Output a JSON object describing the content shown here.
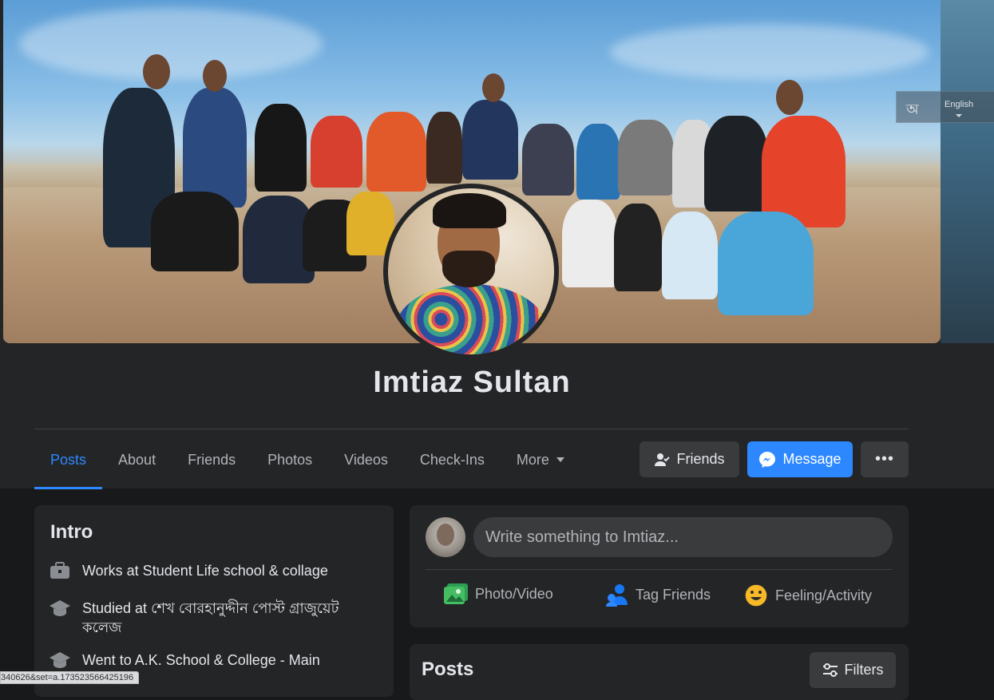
{
  "language_widget": {
    "bangla": "অ",
    "english": "English"
  },
  "profile": {
    "name": "Imtiaz Sultan"
  },
  "tabs": [
    {
      "label": "Posts"
    },
    {
      "label": "About"
    },
    {
      "label": "Friends"
    },
    {
      "label": "Photos"
    },
    {
      "label": "Videos"
    },
    {
      "label": "Check-Ins"
    },
    {
      "label": "More"
    }
  ],
  "actions": {
    "friends": "Friends",
    "message": "Message",
    "more": "•••"
  },
  "intro": {
    "title": "Intro",
    "items": [
      {
        "icon": "briefcase-icon",
        "text": "Works at Student Life school & collage"
      },
      {
        "icon": "graduation-cap-icon",
        "text": "Studied at শেখ বোরহানুদ্দীন পোস্ট গ্রাজুয়েট কলেজ"
      },
      {
        "icon": "graduation-cap-icon",
        "text": "Went to A.K. School & College - Main"
      }
    ]
  },
  "composer": {
    "placeholder": "Write something to Imtiaz...",
    "photo_video": "Photo/Video",
    "tag_friends": "Tag Friends",
    "feeling": "Feeling/Activity"
  },
  "posts": {
    "title": "Posts",
    "filters": "Filters"
  },
  "status_url": "340626&set=a.173523566425196",
  "colors": {
    "accent": "#2d88ff",
    "background": "#18191a",
    "surface": "#242526",
    "button": "#3a3b3c"
  }
}
